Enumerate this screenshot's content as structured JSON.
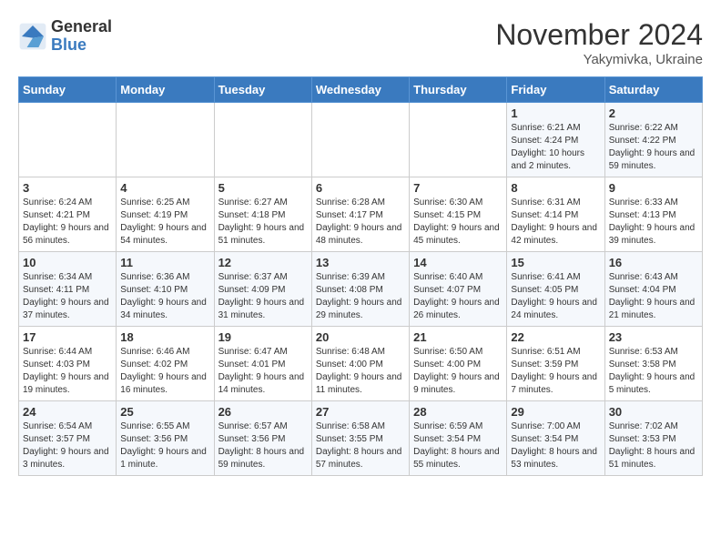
{
  "header": {
    "logo_line1": "General",
    "logo_line2": "Blue",
    "month_title": "November 2024",
    "subtitle": "Yakymivka, Ukraine"
  },
  "days_of_week": [
    "Sunday",
    "Monday",
    "Tuesday",
    "Wednesday",
    "Thursday",
    "Friday",
    "Saturday"
  ],
  "weeks": [
    [
      {
        "day": "",
        "info": ""
      },
      {
        "day": "",
        "info": ""
      },
      {
        "day": "",
        "info": ""
      },
      {
        "day": "",
        "info": ""
      },
      {
        "day": "",
        "info": ""
      },
      {
        "day": "1",
        "info": "Sunrise: 6:21 AM\nSunset: 4:24 PM\nDaylight: 10 hours and 2 minutes."
      },
      {
        "day": "2",
        "info": "Sunrise: 6:22 AM\nSunset: 4:22 PM\nDaylight: 9 hours and 59 minutes."
      }
    ],
    [
      {
        "day": "3",
        "info": "Sunrise: 6:24 AM\nSunset: 4:21 PM\nDaylight: 9 hours and 56 minutes."
      },
      {
        "day": "4",
        "info": "Sunrise: 6:25 AM\nSunset: 4:19 PM\nDaylight: 9 hours and 54 minutes."
      },
      {
        "day": "5",
        "info": "Sunrise: 6:27 AM\nSunset: 4:18 PM\nDaylight: 9 hours and 51 minutes."
      },
      {
        "day": "6",
        "info": "Sunrise: 6:28 AM\nSunset: 4:17 PM\nDaylight: 9 hours and 48 minutes."
      },
      {
        "day": "7",
        "info": "Sunrise: 6:30 AM\nSunset: 4:15 PM\nDaylight: 9 hours and 45 minutes."
      },
      {
        "day": "8",
        "info": "Sunrise: 6:31 AM\nSunset: 4:14 PM\nDaylight: 9 hours and 42 minutes."
      },
      {
        "day": "9",
        "info": "Sunrise: 6:33 AM\nSunset: 4:13 PM\nDaylight: 9 hours and 39 minutes."
      }
    ],
    [
      {
        "day": "10",
        "info": "Sunrise: 6:34 AM\nSunset: 4:11 PM\nDaylight: 9 hours and 37 minutes."
      },
      {
        "day": "11",
        "info": "Sunrise: 6:36 AM\nSunset: 4:10 PM\nDaylight: 9 hours and 34 minutes."
      },
      {
        "day": "12",
        "info": "Sunrise: 6:37 AM\nSunset: 4:09 PM\nDaylight: 9 hours and 31 minutes."
      },
      {
        "day": "13",
        "info": "Sunrise: 6:39 AM\nSunset: 4:08 PM\nDaylight: 9 hours and 29 minutes."
      },
      {
        "day": "14",
        "info": "Sunrise: 6:40 AM\nSunset: 4:07 PM\nDaylight: 9 hours and 26 minutes."
      },
      {
        "day": "15",
        "info": "Sunrise: 6:41 AM\nSunset: 4:05 PM\nDaylight: 9 hours and 24 minutes."
      },
      {
        "day": "16",
        "info": "Sunrise: 6:43 AM\nSunset: 4:04 PM\nDaylight: 9 hours and 21 minutes."
      }
    ],
    [
      {
        "day": "17",
        "info": "Sunrise: 6:44 AM\nSunset: 4:03 PM\nDaylight: 9 hours and 19 minutes."
      },
      {
        "day": "18",
        "info": "Sunrise: 6:46 AM\nSunset: 4:02 PM\nDaylight: 9 hours and 16 minutes."
      },
      {
        "day": "19",
        "info": "Sunrise: 6:47 AM\nSunset: 4:01 PM\nDaylight: 9 hours and 14 minutes."
      },
      {
        "day": "20",
        "info": "Sunrise: 6:48 AM\nSunset: 4:00 PM\nDaylight: 9 hours and 11 minutes."
      },
      {
        "day": "21",
        "info": "Sunrise: 6:50 AM\nSunset: 4:00 PM\nDaylight: 9 hours and 9 minutes."
      },
      {
        "day": "22",
        "info": "Sunrise: 6:51 AM\nSunset: 3:59 PM\nDaylight: 9 hours and 7 minutes."
      },
      {
        "day": "23",
        "info": "Sunrise: 6:53 AM\nSunset: 3:58 PM\nDaylight: 9 hours and 5 minutes."
      }
    ],
    [
      {
        "day": "24",
        "info": "Sunrise: 6:54 AM\nSunset: 3:57 PM\nDaylight: 9 hours and 3 minutes."
      },
      {
        "day": "25",
        "info": "Sunrise: 6:55 AM\nSunset: 3:56 PM\nDaylight: 9 hours and 1 minute."
      },
      {
        "day": "26",
        "info": "Sunrise: 6:57 AM\nSunset: 3:56 PM\nDaylight: 8 hours and 59 minutes."
      },
      {
        "day": "27",
        "info": "Sunrise: 6:58 AM\nSunset: 3:55 PM\nDaylight: 8 hours and 57 minutes."
      },
      {
        "day": "28",
        "info": "Sunrise: 6:59 AM\nSunset: 3:54 PM\nDaylight: 8 hours and 55 minutes."
      },
      {
        "day": "29",
        "info": "Sunrise: 7:00 AM\nSunset: 3:54 PM\nDaylight: 8 hours and 53 minutes."
      },
      {
        "day": "30",
        "info": "Sunrise: 7:02 AM\nSunset: 3:53 PM\nDaylight: 8 hours and 51 minutes."
      }
    ]
  ]
}
